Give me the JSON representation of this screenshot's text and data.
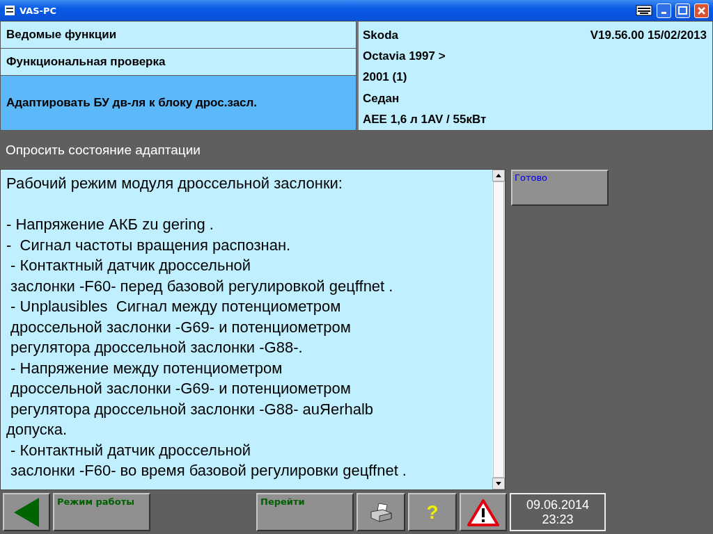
{
  "window": {
    "title": "VAS-PC"
  },
  "functions": [
    {
      "label": "Ведомые функции",
      "selected": false
    },
    {
      "label": "Функциональная проверка",
      "selected": false
    },
    {
      "label": "Адаптировать БУ дв-ля к блоку дрос.засл.",
      "selected": true
    }
  ],
  "vehicle": {
    "make": "Skoda",
    "version": "V19.56.00 15/02/2013",
    "model": "Octavia 1997 >",
    "year": "2001 (1)",
    "body": "Седан",
    "engine": "AEE 1,6 л 1AV / 55кВт"
  },
  "section_title": "Опросить состояние адаптации",
  "text_paragraphs": [
    [
      "Рабочий режим модуля дроссельной заслонки:"
    ],
    [
      "- Напряжение АКБ zu gering .",
      "-  Сигнал частоты вращения распознан.",
      " - Контактный датчик дроссельной",
      " заслонки -F60- перед базовой регулировкой geцffnet .",
      " - Unplausibles  Сигнал между потенциометром",
      " дроссельной заслонки -G69- и потенциометром",
      " регулятора дроссельной заслонки -G88-.",
      " - Напряжение между потенциометром",
      " дроссельной заслонки -G69- и потенциометром",
      " регулятора дроссельной заслонки -G88- auЯerhalb",
      "допуска.",
      " - Контактный датчик дроссельной",
      " заслонки -F60- во время базовой регулировки geцffnet ."
    ]
  ],
  "side_buttons": [
    "Готово"
  ],
  "footer": {
    "mode_button": "Режим работы",
    "goto_button": "Перейти",
    "help": "?",
    "date": "09.06.2014",
    "time": "23:23"
  }
}
